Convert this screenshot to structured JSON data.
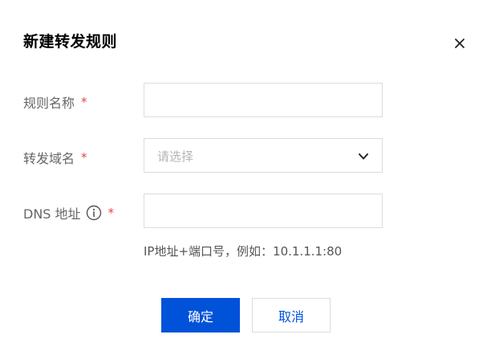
{
  "dialog": {
    "title": "新建转发规则",
    "close_icon": "close-icon"
  },
  "form": {
    "rule_name": {
      "label": "规则名称",
      "required_mark": "*",
      "value": ""
    },
    "forward_domain": {
      "label": "转发域名",
      "required_mark": "*",
      "placeholder": "请选择",
      "icon": "chevron-down-icon"
    },
    "dns_address": {
      "label": "DNS 地址",
      "required_mark": "*",
      "info_icon": "info-icon",
      "value": "",
      "hint": "IP地址+端口号，例如：10.1.1.1:80"
    }
  },
  "buttons": {
    "confirm_label": "确定",
    "cancel_label": "取消"
  },
  "colors": {
    "primary": "#0052d9",
    "required": "#e54545",
    "border": "#dcdcdc",
    "placeholder": "#b5b5b5"
  }
}
